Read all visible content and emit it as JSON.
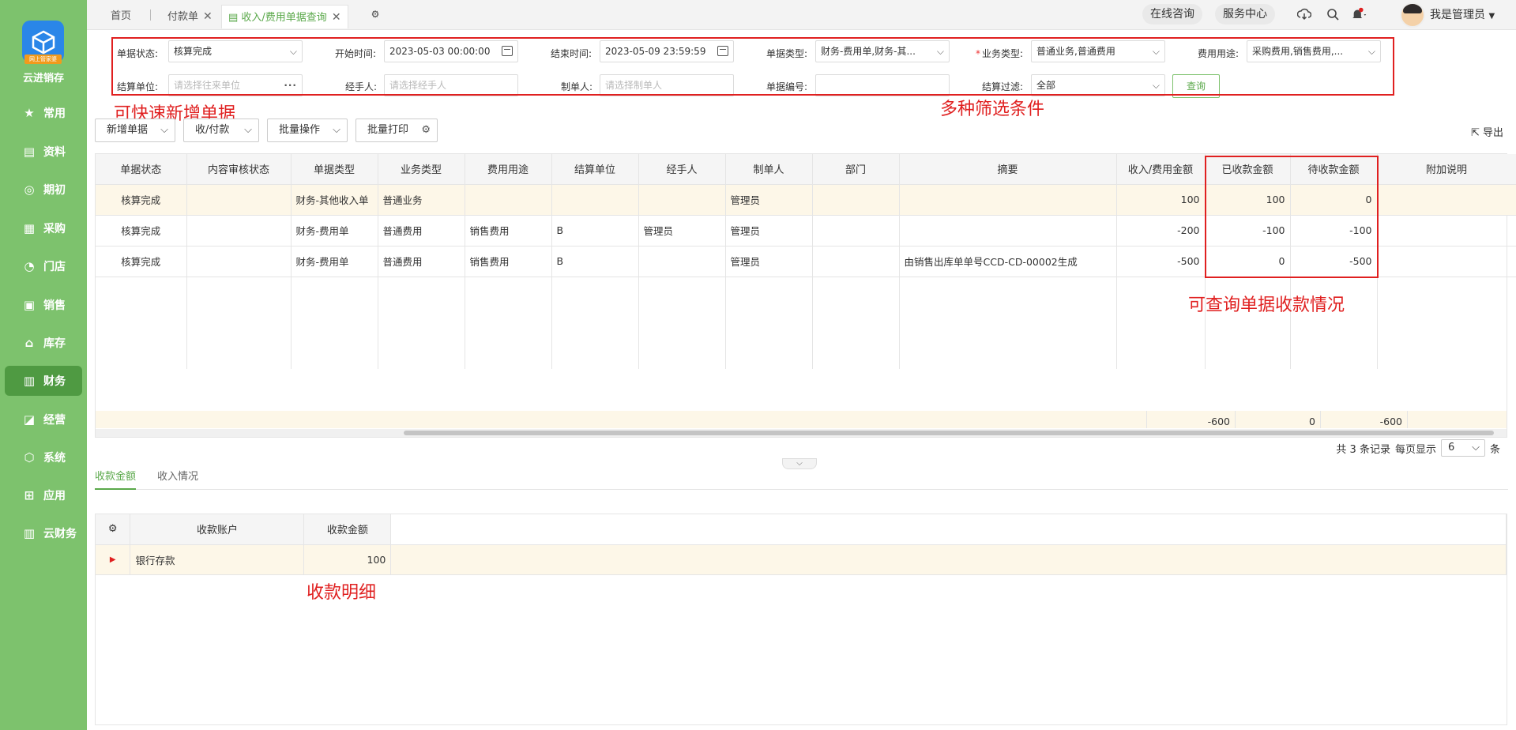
{
  "sidebar": {
    "brand": "云进销存",
    "logo_tag": "网上管家婆",
    "items": [
      {
        "label": "常用",
        "icon": "star-icon",
        "glyph": "★"
      },
      {
        "label": "资料",
        "icon": "document-icon",
        "glyph": "▤"
      },
      {
        "label": "期初",
        "icon": "target-icon",
        "glyph": "◎"
      },
      {
        "label": "采购",
        "icon": "clipboard-icon",
        "glyph": "▦"
      },
      {
        "label": "门店",
        "icon": "pie-icon",
        "glyph": "◔"
      },
      {
        "label": "销售",
        "icon": "wallet-icon",
        "glyph": "▣"
      },
      {
        "label": "库存",
        "icon": "house-icon",
        "glyph": "⌂"
      },
      {
        "label": "财务",
        "icon": "finance-icon",
        "glyph": "▥"
      },
      {
        "label": "经营",
        "icon": "chart-icon",
        "glyph": "◪"
      },
      {
        "label": "系统",
        "icon": "hexagon-icon",
        "glyph": "⬡"
      },
      {
        "label": "应用",
        "icon": "plus-square-icon",
        "glyph": "⊞"
      },
      {
        "label": "云财务",
        "icon": "cloud-finance-icon",
        "glyph": "▥"
      }
    ],
    "active_index": 7
  },
  "topbar": {
    "tabs": [
      {
        "label": "首页"
      },
      {
        "label": "付款单"
      },
      {
        "label": "收入/费用单据查询"
      }
    ],
    "consult": "在线咨询",
    "service": "服务中心",
    "user": "我是管理员"
  },
  "filters": {
    "status_label": "单据状态:",
    "status_value": "核算完成",
    "start_label": "开始时间:",
    "start_value": "2023-05-03 00:00:00",
    "end_label": "结束时间:",
    "end_value": "2023-05-09 23:59:59",
    "type_label": "单据类型:",
    "type_value": "财务-费用单,财务-其...",
    "biz_label": "业务类型:",
    "biz_value": "普通业务,普通费用",
    "use_label": "费用用途:",
    "use_value": "采购费用,销售费用,...",
    "unit_label": "结算单位:",
    "unit_placeholder": "请选择往来单位",
    "handler_label": "经手人:",
    "handler_placeholder": "请选择经手人",
    "maker_label": "制单人:",
    "maker_placeholder": "请选择制单人",
    "no_label": "单据编号:",
    "no_value": "",
    "settle_label": "结算过滤:",
    "settle_value": "全部",
    "query": "查询"
  },
  "annotations": {
    "quick_add": "可快速新增单据",
    "filters": "多种筛选条件",
    "collection": "可查询单据收款情况",
    "detail": "收款明细"
  },
  "toolbar": {
    "new_doc": "新增单据",
    "receive_pay": "收/付款",
    "batch": "批量操作",
    "print": "批量打印",
    "export": "导出"
  },
  "table": {
    "columns": [
      "单据状态",
      "内容审核状态",
      "单据类型",
      "业务类型",
      "费用用途",
      "结算单位",
      "经手人",
      "制单人",
      "部门",
      "摘要",
      "收入/费用金额",
      "已收款金额",
      "待收款金额",
      "附加说明"
    ],
    "rows": [
      [
        "核算完成",
        "",
        "财务-其他收入单",
        "普通业务",
        "",
        "",
        "",
        "管理员",
        "",
        "",
        "100",
        "100",
        "0",
        ""
      ],
      [
        "核算完成",
        "",
        "财务-费用单",
        "普通费用",
        "销售费用",
        "B",
        "管理员",
        "管理员",
        "",
        "",
        "-200",
        "-100",
        "-100",
        ""
      ],
      [
        "核算完成",
        "",
        "财务-费用单",
        "普通费用",
        "销售费用",
        "B",
        "",
        "管理员",
        "",
        "由销售出库单单号CCD-CD-00002生成",
        "-500",
        "0",
        "-500",
        ""
      ]
    ],
    "totals": {
      "amount": "-600",
      "received": "0",
      "pending": "-600"
    }
  },
  "pager": {
    "total": "共 3 条记录",
    "per_page_label": "每页显示",
    "per_page": "6",
    "unit": "条"
  },
  "bottom": {
    "tabs": [
      "收款金额",
      "收入情况"
    ],
    "columns": [
      "收款账户",
      "收款金额"
    ],
    "rows": [
      [
        "银行存款",
        "100"
      ]
    ]
  }
}
